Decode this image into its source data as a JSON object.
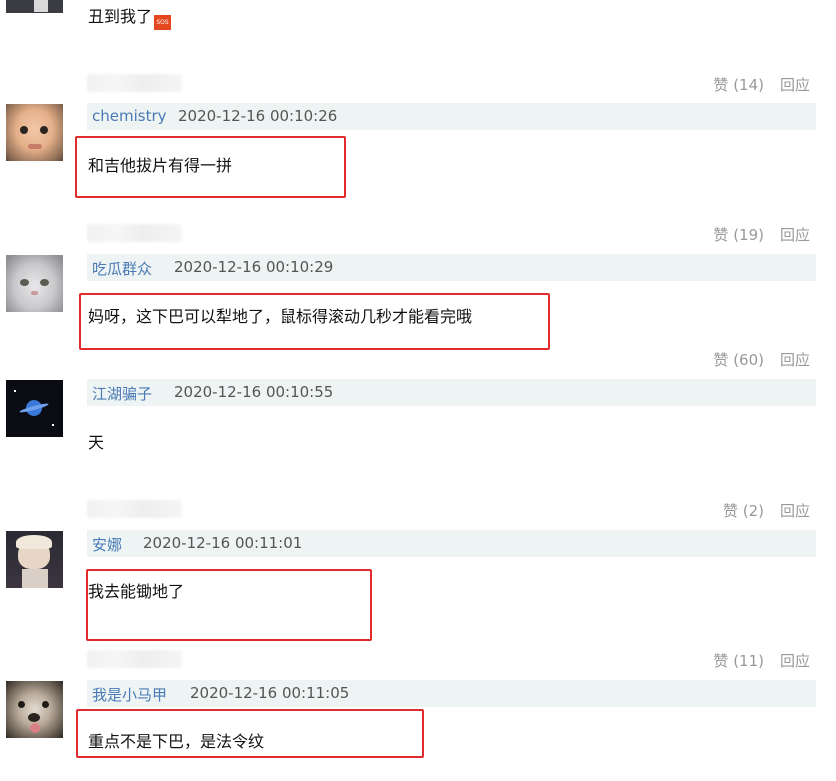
{
  "top_comment": {
    "text": "丑到我了",
    "emoji": "sos"
  },
  "icons": {
    "sos_emoji": "sos-emoji-icon"
  },
  "comments": [
    {
      "username": "chemistry",
      "time": "2020-12-16 00:10:26",
      "content": "和吉他拔片有得一拼",
      "likes_above": "赞 (14)",
      "reply_above": "回应"
    },
    {
      "username": "吃瓜群众",
      "time": "2020-12-16 00:10:29",
      "content": "妈呀，这下巴可以犁地了，鼠标得滚动几秒才能看完哦",
      "likes_above": "赞 (19)",
      "reply_above": "回应"
    },
    {
      "username": "江湖骗子",
      "time": "2020-12-16 00:10:55",
      "content": "天",
      "likes_above": "赞 (60)",
      "reply_above": "回应"
    },
    {
      "username": "安娜",
      "time": "2020-12-16 00:11:01",
      "content": "我去能锄地了",
      "likes_above": "赞 (2)",
      "reply_above": "回应"
    },
    {
      "username": "我是小马甲",
      "time": "2020-12-16 00:11:05",
      "content": "重点不是下巴，是法令纹",
      "likes_above": "赞 (11)",
      "reply_above": "回应"
    }
  ],
  "colors": {
    "username": "#4a7ab5",
    "header_bg": "#eef4f3",
    "highlight_border": "#e02c2c",
    "action_text": "#999999"
  }
}
